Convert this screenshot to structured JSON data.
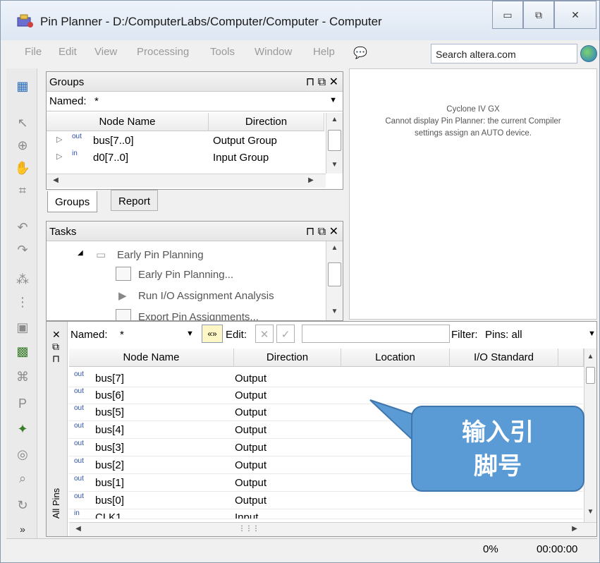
{
  "window": {
    "title": "Pin Planner - D:/ComputerLabs/Computer/Computer - Computer",
    "minimize": "▭",
    "maximize": "⧉",
    "close": "✕"
  },
  "menu": [
    "File",
    "Edit",
    "View",
    "Processing",
    "Tools",
    "Window",
    "Help"
  ],
  "search": {
    "value": "Search altera.com"
  },
  "groups_panel": {
    "title": "Groups",
    "named_label": "Named:",
    "named_value": "*",
    "columns": [
      "Node Name",
      "Direction"
    ],
    "rows": [
      {
        "badge": "out",
        "name": "bus[7..0]",
        "direction": "Output Group"
      },
      {
        "badge": "in",
        "name": "d0[7..0]",
        "direction": "Input Group"
      }
    ],
    "tabs": [
      "Groups",
      "Report"
    ]
  },
  "tasks_panel": {
    "title": "Tasks",
    "items": [
      "Early Pin Planning",
      "Early Pin Planning...",
      "Run I/O Assignment Analysis",
      "Export Pin Assignments..."
    ]
  },
  "right_pane": {
    "line1": "Cyclone IV GX",
    "line2": "Cannot display Pin Planner: the current Compiler",
    "line3": "settings assign an AUTO device."
  },
  "pins_panel": {
    "named_label": "Named:",
    "named_value": "*",
    "edit_label": "Edit:",
    "filter_label": "Filter:",
    "filter_value": "Pins: all",
    "side_tab": "All Pins",
    "columns": [
      "Node Name",
      "Direction",
      "Location",
      "I/O Standard"
    ],
    "rows": [
      {
        "badge": "out",
        "name": "bus[7]",
        "direction": "Output"
      },
      {
        "badge": "out",
        "name": "bus[6]",
        "direction": "Output"
      },
      {
        "badge": "out",
        "name": "bus[5]",
        "direction": "Output"
      },
      {
        "badge": "out",
        "name": "bus[4]",
        "direction": "Output"
      },
      {
        "badge": "out",
        "name": "bus[3]",
        "direction": "Output"
      },
      {
        "badge": "out",
        "name": "bus[2]",
        "direction": "Output"
      },
      {
        "badge": "out",
        "name": "bus[1]",
        "direction": "Output"
      },
      {
        "badge": "out",
        "name": "bus[0]",
        "direction": "Output"
      },
      {
        "badge": "in",
        "name": "CLK1",
        "direction": "Input"
      }
    ]
  },
  "callout": {
    "line1": "输入引",
    "line2": "脚号"
  },
  "status": {
    "progress": "0%",
    "time": "00:00:00"
  }
}
